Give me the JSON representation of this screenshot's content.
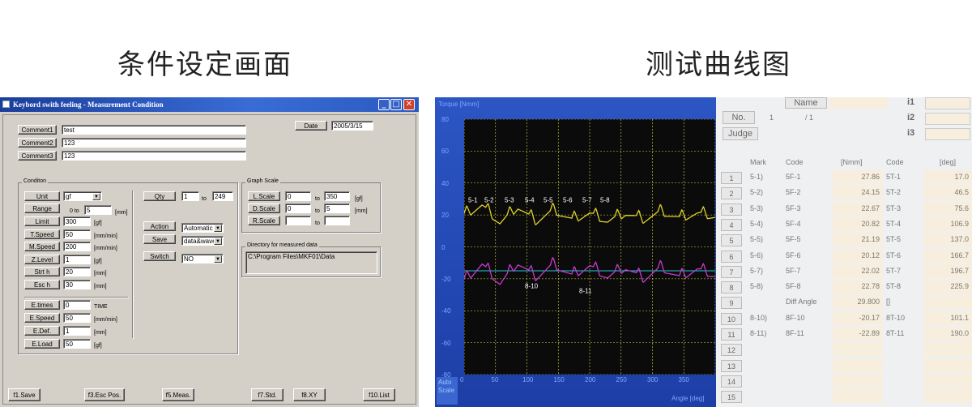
{
  "headings": {
    "left": "条件设定画面",
    "right": "测试曲线图"
  },
  "window": {
    "title": "Keybord swith feeling - Measurement Condition",
    "min": "_",
    "max": "□",
    "close": "✕"
  },
  "comments": [
    {
      "label": "Comment1",
      "value": "test"
    },
    {
      "label": "Comment2",
      "value": "123"
    },
    {
      "label": "Comment3",
      "value": "123"
    }
  ],
  "date": {
    "label": "Date",
    "value": "2005/3/15"
  },
  "condition": {
    "title": "Conditon"
  },
  "unit": {
    "label": "Unit",
    "value": "gf"
  },
  "range": {
    "label": "Range",
    "from": "0 to",
    "value": "5",
    "unit": "[mm]"
  },
  "params1": [
    {
      "label": "Limit",
      "value": "300",
      "unit": "[gf]"
    },
    {
      "label": "T.Speed",
      "value": "50",
      "unit": "[mm/min]"
    },
    {
      "label": "M.Speed",
      "value": "200",
      "unit": "[mm/min]"
    },
    {
      "label": "Z.Level",
      "value": "1",
      "unit": "[gf]"
    },
    {
      "label": "Strt h",
      "value": "20",
      "unit": "[mm]"
    },
    {
      "label": "Esc h",
      "value": "30",
      "unit": "[mm]"
    }
  ],
  "params2": [
    {
      "label": "E.times",
      "value": "0",
      "unit": "TIME"
    },
    {
      "label": "E.Speed",
      "value": "50",
      "unit": "[mm/min]"
    },
    {
      "label": "E.Def.",
      "value": "1",
      "unit": "[mm]"
    },
    {
      "label": "E.Load",
      "value": "50",
      "unit": "[gf]"
    }
  ],
  "qty": {
    "label": "Qty",
    "from": "1",
    "to": "to",
    "value": "249"
  },
  "action": {
    "label": "Action",
    "value": "Automatic"
  },
  "save": {
    "label": "Save",
    "value": "data&wave"
  },
  "switch": {
    "label": "Switch",
    "value": "NO"
  },
  "graph_scale": {
    "title": "Graph Scale",
    "to": "to",
    "rows": [
      {
        "label": "L.Scale",
        "from": "0",
        "value": "350",
        "unit": "[gf]"
      },
      {
        "label": "D.Scale",
        "from": "0",
        "value": "5",
        "unit": "[mm]"
      },
      {
        "label": "R.Scale",
        "from": "",
        "value": "",
        "unit": ""
      }
    ]
  },
  "directory": {
    "title": "Directory for measured data",
    "value": "C:\\Program Files\\MKF01\\Data"
  },
  "footer": [
    "f1.Save",
    "f3.Esc Pos.",
    "f5.Meas.",
    "f7.Std.",
    "f8.XY",
    "f10.List"
  ],
  "plot": {
    "ylabel": "Torque [Nmm]",
    "xlabel": "Angle [deg]",
    "autoscale": "Auto Scale",
    "yticks": [
      "80",
      "60",
      "40",
      "20",
      "0",
      "-20",
      "-40",
      "-60",
      "-80"
    ],
    "xticks": [
      "0",
      "50",
      "100",
      "150",
      "200",
      "250",
      "300",
      "350"
    ],
    "marks": [
      "5-1",
      "5-2",
      "5-3",
      "5-4",
      "5-5",
      "5-6",
      "5-7",
      "5-8"
    ],
    "marks2": [
      "8-10",
      "8-11"
    ],
    "colors": {
      "torque": "#e0d22a",
      "angle": "#c83ad0",
      "base": "#27c7d8",
      "grid": "#dcdc4a"
    }
  },
  "chart_data": {
    "type": "line",
    "title": "",
    "xlabel": "Angle [deg]",
    "ylabel": "Torque [Nmm]",
    "xlim": [
      0,
      350
    ],
    "ylim": [
      -80,
      80
    ],
    "grid": true,
    "x": [
      0,
      25,
      50,
      75,
      100,
      125,
      150,
      175,
      200,
      225,
      250,
      275,
      300,
      325,
      350
    ],
    "series": [
      {
        "values": [
          21,
          27,
          16,
          26,
          17,
          24,
          18,
          22,
          17,
          22,
          18,
          23,
          19,
          22,
          20
        ]
      },
      {
        "values": [
          -20,
          -10,
          -22,
          -9,
          -18,
          -10,
          -17,
          -11,
          -18,
          -12,
          -19,
          -12,
          -18,
          -13,
          -17
        ]
      }
    ]
  },
  "table": {
    "name_label": "Name",
    "no_label": "No.",
    "no_value": "1",
    "no_total": "/ 1",
    "judge_label": "Judge",
    "i_labels": [
      "i1",
      "i2",
      "i3"
    ],
    "headers": [
      "Mark",
      "Code",
      "[Nmm]",
      "Code",
      "[deg]"
    ],
    "rows": [
      {
        "n": "1",
        "mark": "5-1)",
        "code": "5F-1",
        "nmm": "27.86",
        "code2": "5T-1",
        "deg": "17.0"
      },
      {
        "n": "2",
        "mark": "5-2)",
        "code": "5F-2",
        "nmm": "24.15",
        "code2": "5T-2",
        "deg": "46.5"
      },
      {
        "n": "3",
        "mark": "5-3)",
        "code": "5F-3",
        "nmm": "22.67",
        "code2": "5T-3",
        "deg": "75.6"
      },
      {
        "n": "4",
        "mark": "5-4)",
        "code": "5F-4",
        "nmm": "20.82",
        "code2": "5T-4",
        "deg": "106.9"
      },
      {
        "n": "5",
        "mark": "5-5)",
        "code": "5F-5",
        "nmm": "21.19",
        "code2": "5T-5",
        "deg": "137.0"
      },
      {
        "n": "6",
        "mark": "5-6)",
        "code": "5F-6",
        "nmm": "20.12",
        "code2": "5T-6",
        "deg": "166.7"
      },
      {
        "n": "7",
        "mark": "5-7)",
        "code": "5F-7",
        "nmm": "22.02",
        "code2": "5T-7",
        "deg": "196.7"
      },
      {
        "n": "8",
        "mark": "5-8)",
        "code": "5F-8",
        "nmm": "22.78",
        "code2": "5T-8",
        "deg": "225.9"
      },
      {
        "n": "9",
        "mark": "",
        "code": "Diff Angle",
        "nmm": "29.800",
        "code2": "[]",
        "deg": ""
      },
      {
        "n": "10",
        "mark": "8-10)",
        "code": "8F-10",
        "nmm": "-20.17",
        "code2": "8T-10",
        "deg": "101.1"
      },
      {
        "n": "11",
        "mark": "8-11)",
        "code": "8F-11",
        "nmm": "-22.89",
        "code2": "8T-11",
        "deg": "190.0"
      },
      {
        "n": "12",
        "mark": "",
        "code": "",
        "nmm": "",
        "code2": "",
        "deg": ""
      },
      {
        "n": "13",
        "mark": "",
        "code": "",
        "nmm": "",
        "code2": "",
        "deg": ""
      },
      {
        "n": "14",
        "mark": "",
        "code": "",
        "nmm": "",
        "code2": "",
        "deg": ""
      },
      {
        "n": "15",
        "mark": "",
        "code": "",
        "nmm": "",
        "code2": "",
        "deg": ""
      }
    ]
  }
}
